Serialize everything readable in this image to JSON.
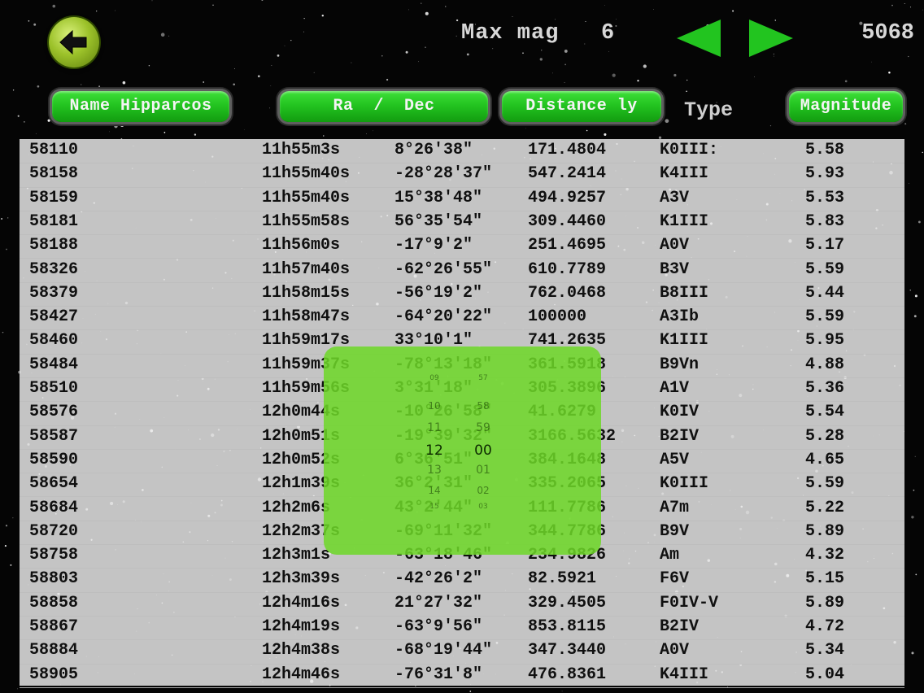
{
  "header": {
    "back_icon": "back-arrow-icon",
    "max_mag_label": "Max mag",
    "max_mag_value": "6",
    "prev_icon": "triangle-left-icon",
    "next_icon": "triangle-right-icon",
    "count": "5068",
    "accent_color": "#22c41f"
  },
  "columns": {
    "name": "Name Hipparcos",
    "radec": "Ra  /  Dec",
    "distance": "Distance ly",
    "type": "Type",
    "magnitude": "Magnitude"
  },
  "rows": [
    {
      "hip": "58110",
      "ra": "11h55m3s",
      "dec": "8°26'38\"",
      "dist": "171.4804",
      "type": "K0III:",
      "mag": "5.58"
    },
    {
      "hip": "58158",
      "ra": "11h55m40s",
      "dec": "-28°28'37\"",
      "dist": "547.2414",
      "type": "K4III",
      "mag": "5.93"
    },
    {
      "hip": "58159",
      "ra": "11h55m40s",
      "dec": "15°38'48\"",
      "dist": "494.9257",
      "type": "A3V",
      "mag": "5.53"
    },
    {
      "hip": "58181",
      "ra": "11h55m58s",
      "dec": "56°35'54\"",
      "dist": "309.4460",
      "type": "K1III",
      "mag": "5.83"
    },
    {
      "hip": "58188",
      "ra": "11h56m0s",
      "dec": "-17°9'2\"",
      "dist": "251.4695",
      "type": "A0V",
      "mag": "5.17"
    },
    {
      "hip": "58326",
      "ra": "11h57m40s",
      "dec": "-62°26'55\"",
      "dist": "610.7789",
      "type": "B3V",
      "mag": "5.59"
    },
    {
      "hip": "58379",
      "ra": "11h58m15s",
      "dec": "-56°19'2\"",
      "dist": "762.0468",
      "type": "B8III",
      "mag": "5.44"
    },
    {
      "hip": "58427",
      "ra": "11h58m47s",
      "dec": "-64°20'22\"",
      "dist": "100000",
      "type": "A3Ib",
      "mag": "5.59"
    },
    {
      "hip": "58460",
      "ra": "11h59m17s",
      "dec": "33°10'1\"",
      "dist": "741.2635",
      "type": "K1III",
      "mag": "5.95"
    },
    {
      "hip": "58484",
      "ra": "11h59m37s",
      "dec": "-78°13'18\"",
      "dist": "361.5918",
      "type": "B9Vn",
      "mag": "4.88"
    },
    {
      "hip": "58510",
      "ra": "11h59m56s",
      "dec": "3°31'18\"",
      "dist": "305.3896",
      "type": "A1V",
      "mag": "5.36"
    },
    {
      "hip": "58576",
      "ra": "12h0m44s",
      "dec": "-10°26'58\"",
      "dist": "41.6279",
      "type": "K0IV",
      "mag": "5.54"
    },
    {
      "hip": "58587",
      "ra": "12h0m51s",
      "dec": "-19°39'32\"",
      "dist": "3166.5632",
      "type": "B2IV",
      "mag": "5.28"
    },
    {
      "hip": "58590",
      "ra": "12h0m52s",
      "dec": "6°36'51\"",
      "dist": "384.1648",
      "type": "A5V",
      "mag": "4.65"
    },
    {
      "hip": "58654",
      "ra": "12h1m39s",
      "dec": "36°2'31\"",
      "dist": "335.2065",
      "type": "K0III",
      "mag": "5.59"
    },
    {
      "hip": "58684",
      "ra": "12h2m6s",
      "dec": "43°2'44\"",
      "dist": "111.7786",
      "type": "A7m",
      "mag": "5.22"
    },
    {
      "hip": "58720",
      "ra": "12h2m37s",
      "dec": "-69°11'32\"",
      "dist": "344.7786",
      "type": "B9V",
      "mag": "5.89"
    },
    {
      "hip": "58758",
      "ra": "12h3m1s",
      "dec": "-63°18'46\"",
      "dist": "234.9826",
      "type": "Am",
      "mag": "4.32"
    },
    {
      "hip": "58803",
      "ra": "12h3m39s",
      "dec": "-42°26'2\"",
      "dist": "82.5921",
      "type": "F6V",
      "mag": "5.15"
    },
    {
      "hip": "58858",
      "ra": "12h4m16s",
      "dec": "21°27'32\"",
      "dist": "329.4505",
      "type": "F0IV-V",
      "mag": "5.89"
    },
    {
      "hip": "58867",
      "ra": "12h4m19s",
      "dec": "-63°9'56\"",
      "dist": "853.8115",
      "type": "B2IV",
      "mag": "4.72"
    },
    {
      "hip": "58884",
      "ra": "12h4m38s",
      "dec": "-68°19'44\"",
      "dist": "347.3440",
      "type": "A0V",
      "mag": "5.34"
    },
    {
      "hip": "58905",
      "ra": "12h4m46s",
      "dec": "-76°31'8\"",
      "dist": "476.8361",
      "type": "K4III",
      "mag": "5.04"
    }
  ],
  "picker": {
    "hours": [
      "09",
      "10",
      "11",
      "12",
      "13",
      "14",
      "15"
    ],
    "minutes": [
      "57",
      "58",
      "59",
      "00",
      "01",
      "02",
      "03"
    ],
    "selected_hour": "12",
    "selected_minute": "00",
    "color": "#6ed728"
  }
}
